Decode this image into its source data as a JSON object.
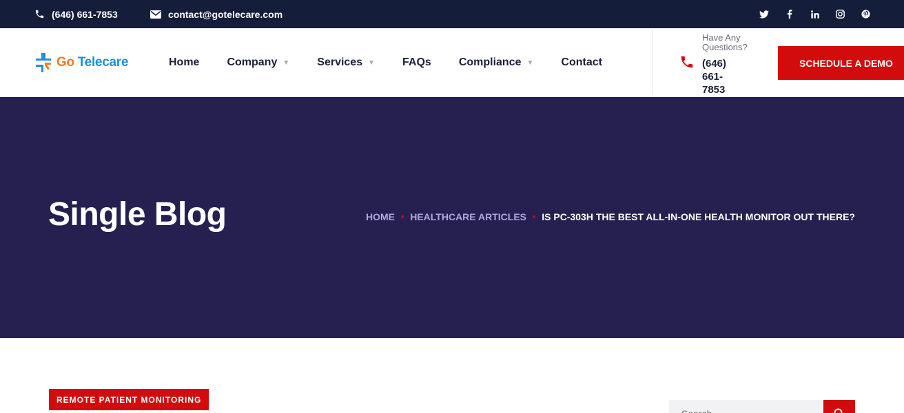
{
  "topbar": {
    "phone": "(646) 661-7853",
    "email": "contact@gotelecare.com",
    "social_icons": [
      "twitter-icon",
      "facebook-icon",
      "linkedin-icon",
      "instagram-icon",
      "pinterest-icon"
    ]
  },
  "header": {
    "logo": {
      "go": "Go",
      "telecare": "Telecare"
    },
    "nav": [
      {
        "label": "Home",
        "dropdown": false
      },
      {
        "label": "Company",
        "dropdown": true
      },
      {
        "label": "Services",
        "dropdown": true
      },
      {
        "label": "FAQs",
        "dropdown": false
      },
      {
        "label": "Compliance",
        "dropdown": true
      },
      {
        "label": "Contact",
        "dropdown": false
      }
    ],
    "caret": "▼",
    "question": "Have Any Questions?",
    "phone": "(646) 661-7853",
    "cta": "SCHEDULE A DEMO"
  },
  "hero": {
    "title": "Single Blog",
    "breadcrumb": {
      "home": "HOME",
      "category": "HEALTHCARE ARTICLES",
      "current": "IS PC-303H THE BEST ALL-IN-ONE HEALTH MONITOR OUT THERE?",
      "separator": "■"
    }
  },
  "content": {
    "category_badge": "REMOTE PATIENT MONITORING",
    "search_placeholder": "Search..."
  },
  "colors": {
    "topbar": "#141d3a",
    "hero": "#25204f",
    "accent_red": "#d20c0c",
    "logo_orange": "#ef7d22",
    "logo_blue": "#1f8fd6"
  }
}
